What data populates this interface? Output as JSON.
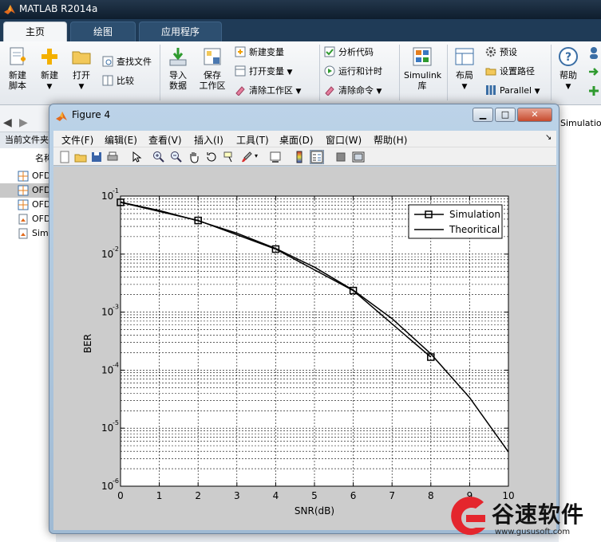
{
  "app": {
    "title": "MATLAB R2014a"
  },
  "ribbon": {
    "tabs": [
      {
        "label": "主页",
        "active": true
      },
      {
        "label": "绘图",
        "active": false
      },
      {
        "label": "应用程序",
        "active": false
      }
    ],
    "buttons": {
      "new_script": "新建\n脚本",
      "new": "新建",
      "open": "打开",
      "find_files": "查找文件",
      "compare": "比较",
      "import_data": "导入\n数据",
      "save_workspace": "保存\n工作区",
      "new_variable": "新建变量",
      "open_variable": "打开变量",
      "clear_workspace": "清除工作区",
      "analyze_code": "分析代码",
      "run_and_time": "运行和计时",
      "clear_commands": "清除命令",
      "simulink": "Simulink\n库",
      "layout": "布局",
      "preferences": "预设",
      "set_path": "设置路径",
      "parallel": "Parallel",
      "help": "帮助"
    }
  },
  "current_folder": {
    "label": "当前文件夹",
    "column_header": "名称",
    "files": [
      {
        "name": "OFDM",
        "icon": "figure-file-icon",
        "selected": false
      },
      {
        "name": "OFDM",
        "icon": "figure-file-icon",
        "selected": true
      },
      {
        "name": "OFDM",
        "icon": "figure-file-icon",
        "selected": false
      },
      {
        "name": "OFDM",
        "icon": "script-file-icon",
        "selected": false
      },
      {
        "name": "Simulation",
        "icon": "script-file-icon",
        "selected": false
      }
    ]
  },
  "right_panel": {
    "snippet": "Simulation"
  },
  "figure": {
    "title": "Figure 4",
    "menus": [
      "文件(F)",
      "编辑(E)",
      "查看(V)",
      "插入(I)",
      "工具(T)",
      "桌面(D)",
      "窗口(W)",
      "帮助(H)"
    ],
    "toolbar_icons": [
      "new-figure-icon",
      "open-file-icon",
      "save-icon",
      "print-icon",
      "select-arrow-icon",
      "zoom-in-icon",
      "zoom-out-icon",
      "pan-hand-icon",
      "rotate-3d-icon",
      "data-cursor-icon",
      "brush-icon",
      "link-plot-icon",
      "colorbar-icon",
      "legend-icon",
      "hide-plot-tools-icon",
      "show-plot-tools-icon"
    ]
  },
  "chart_data": {
    "type": "line",
    "xlabel": "SNR(dB)",
    "ylabel": "BER",
    "xlim": [
      0,
      10
    ],
    "ylim": [
      1e-06,
      0.1
    ],
    "yscale": "log",
    "x_ticks": [
      "0",
      "1",
      "2",
      "3",
      "4",
      "5",
      "6",
      "7",
      "8",
      "9",
      "10"
    ],
    "y_ticks": [
      {
        "base": "10",
        "exp": "-1"
      },
      {
        "base": "10",
        "exp": "-2"
      },
      {
        "base": "10",
        "exp": "-3"
      },
      {
        "base": "10",
        "exp": "-4"
      },
      {
        "base": "10",
        "exp": "-5"
      },
      {
        "base": "10",
        "exp": "-6"
      }
    ],
    "grid": true,
    "legend_position": "top-right",
    "series": [
      {
        "name": "Simulation",
        "marker": "square",
        "x": [
          0,
          2,
          4,
          6,
          8
        ],
        "y": [
          0.078,
          0.038,
          0.0122,
          0.00235,
          0.000168
        ]
      },
      {
        "name": "Theoritical",
        "marker": "none",
        "x": [
          0,
          1,
          2,
          3,
          4,
          5,
          6,
          7,
          8,
          9,
          10
        ],
        "y": [
          0.0786,
          0.0563,
          0.0375,
          0.0229,
          0.0125,
          0.00595,
          0.00239,
          0.000773,
          0.000191,
          3.36e-05,
          3.9e-06
        ]
      }
    ]
  },
  "watermark": {
    "text": "谷速软件",
    "url": "www.gususoft.com"
  },
  "colors": {
    "ribbon_dark": "#1f3b57",
    "figure_frame": "#bcd3e8",
    "figure_body": "#cccccc"
  }
}
